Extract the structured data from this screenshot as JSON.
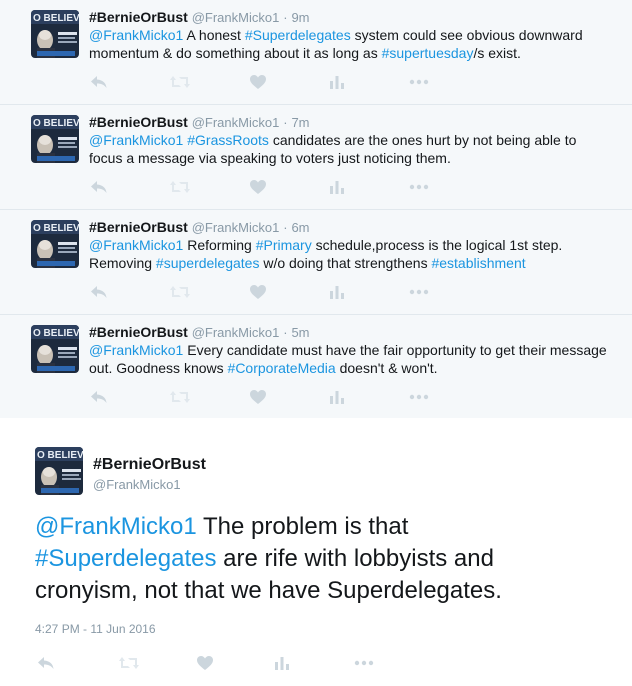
{
  "thread": [
    {
      "fullname": "#BernieOrBust",
      "username": "@FrankMicko1",
      "time": "9m",
      "segments": [
        {
          "type": "mention",
          "text": "@FrankMicko1"
        },
        {
          "type": "text",
          "text": " A honest "
        },
        {
          "type": "hashtag",
          "text": "#Superdelegates"
        },
        {
          "type": "text",
          "text": " system could see obvious downward momentum & do something about it as long as "
        },
        {
          "type": "hashtag",
          "text": "#supertuesday"
        },
        {
          "type": "text",
          "text": "/s exist."
        }
      ]
    },
    {
      "fullname": "#BernieOrBust",
      "username": "@FrankMicko1",
      "time": "7m",
      "segments": [
        {
          "type": "mention",
          "text": "@FrankMicko1"
        },
        {
          "type": "text",
          "text": " "
        },
        {
          "type": "hashtag",
          "text": "#GrassRoots"
        },
        {
          "type": "text",
          "text": " candidates are the ones hurt by not being able to focus a message via speaking to voters just noticing them."
        }
      ]
    },
    {
      "fullname": "#BernieOrBust",
      "username": "@FrankMicko1",
      "time": "6m",
      "segments": [
        {
          "type": "mention",
          "text": "@FrankMicko1"
        },
        {
          "type": "text",
          "text": " Reforming "
        },
        {
          "type": "hashtag",
          "text": "#Primary"
        },
        {
          "type": "text",
          "text": " schedule,process is the logical 1st step. Removing "
        },
        {
          "type": "hashtag",
          "text": "#superdelegates"
        },
        {
          "type": "text",
          "text": " w/o doing that strengthens "
        },
        {
          "type": "hashtag",
          "text": "#establishment"
        }
      ]
    },
    {
      "fullname": "#BernieOrBust",
      "username": "@FrankMicko1",
      "time": "5m",
      "segments": [
        {
          "type": "mention",
          "text": "@FrankMicko1"
        },
        {
          "type": "text",
          "text": " Every candidate must have the fair opportunity to get their message out. Goodness knows "
        },
        {
          "type": "hashtag",
          "text": "#CorporateMedia"
        },
        {
          "type": "text",
          "text": " doesn't & won't."
        }
      ]
    }
  ],
  "main_tweet": {
    "fullname": "#BernieOrBust",
    "username": "@FrankMicko1",
    "timestamp": "4:27 PM - 11 Jun 2016",
    "segments": [
      {
        "type": "mention",
        "text": "@FrankMicko1"
      },
      {
        "type": "text",
        "text": " The problem is that "
      },
      {
        "type": "hashtag",
        "text": "#Superdelegates"
      },
      {
        "type": "text",
        "text": " are rife with lobbyists and cronyism, not that we have Superdelegates."
      }
    ]
  },
  "avatar_text": {
    "top": "O BELIEV",
    "mid": "BERNIE OR BUST",
    "low": "BERNIE OR BUST"
  },
  "colors": {
    "link": "#1b95e0",
    "muted": "#8899a6",
    "icon": "#ccd6dd",
    "thread_bg": "#f5f8fa",
    "divider": "#e1e8ed"
  },
  "icons": [
    "reply-icon",
    "retweet-icon",
    "like-icon",
    "analytics-icon",
    "more-icon"
  ]
}
